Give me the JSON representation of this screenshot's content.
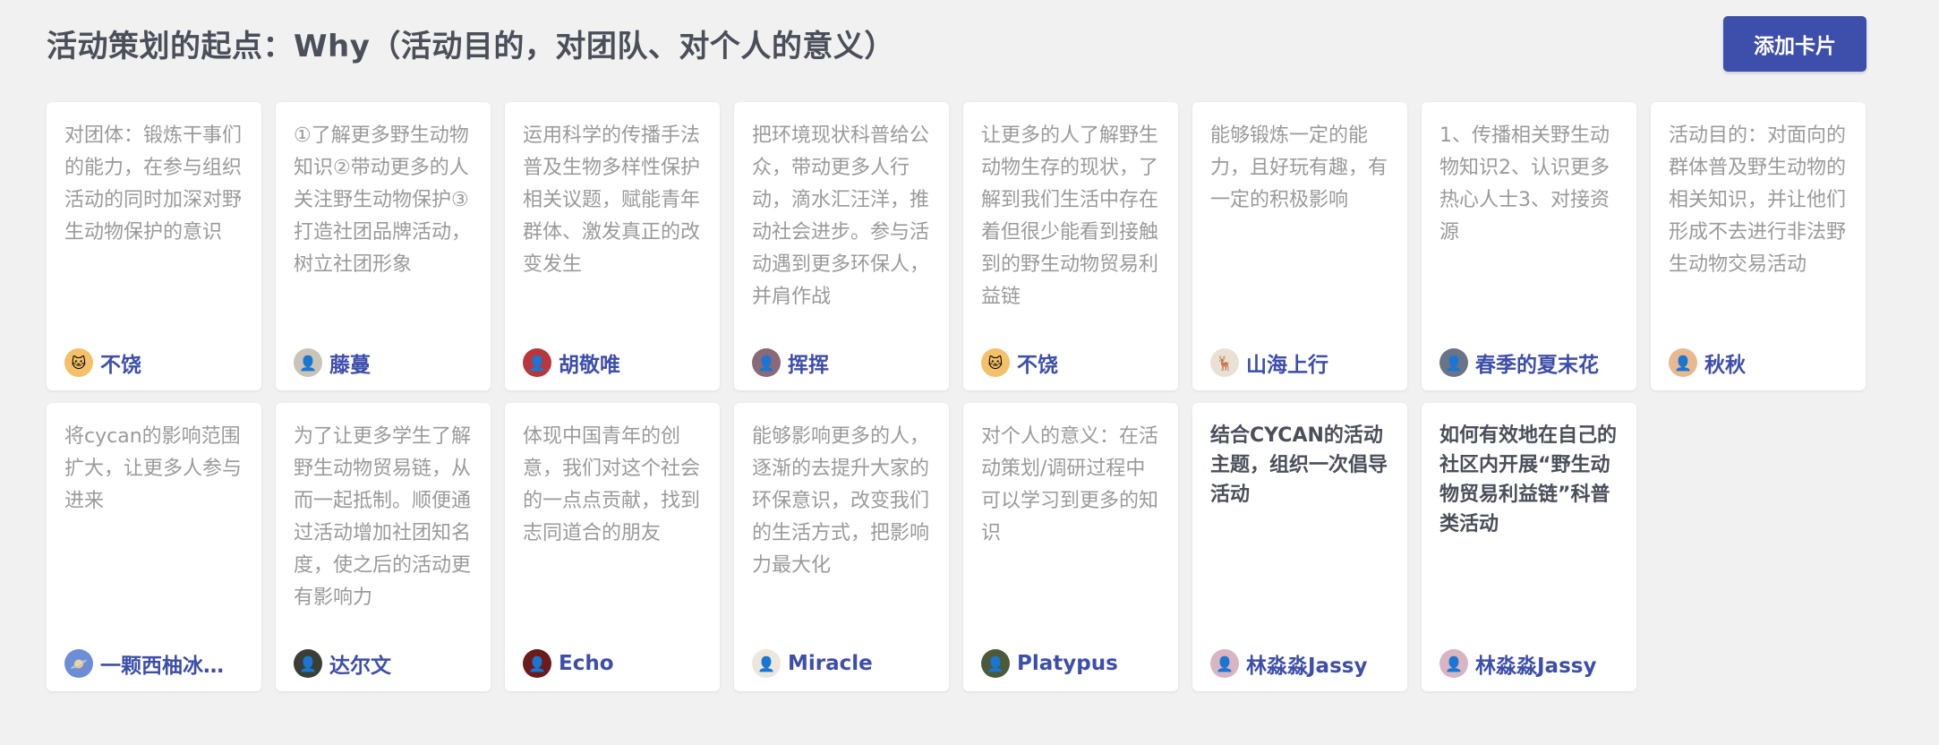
{
  "header": {
    "title": "活动策划的起点：Why（活动目的，对团队、对个人的意义）",
    "add_button_label": "添加卡片"
  },
  "colors": {
    "background": "#f1f1f1",
    "accent": "#3d4eab",
    "body_text": "#9a9a9a",
    "title_text": "#4a4f5a"
  },
  "cards": [
    {
      "content": "对团体：锻炼干事们的能力，在参与组织活动的同时加深对野生动物保护的意识",
      "author": "不饶",
      "avatar_icon": "cat-avatar-icon",
      "avatar_color": "#f4c06a",
      "avatar_glyph": "🐱"
    },
    {
      "content": "①了解更多野生动物知识②带动更多的人关注野生动物保护③打造社团品牌活动，树立社团形象",
      "author": "藤蔓",
      "avatar_icon": "person-avatar-icon",
      "avatar_color": "#c9c3b8",
      "avatar_glyph": "👤"
    },
    {
      "content": "运用科学的传播手法普及生物多样性保护相关议题，赋能青年群体、激发真正的改变发生",
      "author": "胡敬唯",
      "avatar_icon": "person-avatar-icon",
      "avatar_color": "#b8373d",
      "avatar_glyph": "👤"
    },
    {
      "content": "把环境现状科普给公众，带动更多人行动，滴水汇汪洋，推动社会进步。参与活动遇到更多环保人，并肩作战",
      "author": "挥挥",
      "avatar_icon": "person-avatar-icon",
      "avatar_color": "#8a6a78",
      "avatar_glyph": "👤"
    },
    {
      "content": "让更多的人了解野生动物生存的现状，了解到我们生活中存在着但很少能看到接触到的野生动物贸易利益链",
      "author": "不饶",
      "avatar_icon": "cat-avatar-icon",
      "avatar_color": "#f4c06a",
      "avatar_glyph": "🐱"
    },
    {
      "content": "能够锻炼一定的能力，且好玩有趣，有一定的积极影响",
      "author": "山海上行",
      "avatar_icon": "deer-avatar-icon",
      "avatar_color": "#e9e2d4",
      "avatar_glyph": "🦌"
    },
    {
      "content": "1、传播相关野生动物知识2、认识更多热心人士3、对接资源",
      "author": "春季的夏末花",
      "avatar_icon": "person-avatar-icon",
      "avatar_color": "#6b7487",
      "avatar_glyph": "👤"
    },
    {
      "content": "活动目的：对面向的群体普及野生动物的相关知识，并让他们形成不去进行非法野生动物交易活动",
      "author": "秋秋",
      "avatar_icon": "person-avatar-icon",
      "avatar_color": "#e8b98f",
      "avatar_glyph": "👤"
    },
    {
      "content": "将cycan的影响范围扩大，让更多人参与进来",
      "author": "一颗西柚冰…",
      "avatar_icon": "planet-avatar-icon",
      "avatar_color": "#6d8ed6",
      "avatar_glyph": "🪐"
    },
    {
      "content": "为了让更多学生了解野生动物贸易链，从而一起抵制。顺便通过活动增加社团知名度，使之后的活动更有影响力",
      "author": "达尔文",
      "avatar_icon": "person-avatar-icon",
      "avatar_color": "#3a3f36",
      "avatar_glyph": "👤"
    },
    {
      "content": "体现中国青年的创意，我们对这个社会的一点点贡献，找到志同道合的朋友",
      "author": "Echo",
      "avatar_icon": "person-avatar-icon",
      "avatar_color": "#6b1b1b",
      "avatar_glyph": "👤"
    },
    {
      "content": "能够影响更多的人，逐渐的去提升大家的环保意识，改变我们的生活方式，把影响力最大化",
      "author": "Miracle",
      "avatar_icon": "person-avatar-icon",
      "avatar_color": "#ece6dc",
      "avatar_glyph": "👤"
    },
    {
      "content": "对个人的意义：在活动策划/调研过程中可以学习到更多的知识",
      "author": "Platypus",
      "avatar_icon": "person-avatar-icon",
      "avatar_color": "#4d5a3a",
      "avatar_glyph": "👤"
    },
    {
      "content": "结合CYCAN的活动主题，组织一次倡导活动",
      "author": "林淼淼Jassy",
      "avatar_icon": "person-avatar-icon",
      "avatar_color": "#d9b4c2",
      "avatar_glyph": "👤",
      "is_title": true
    },
    {
      "content": "如何有效地在自己的社区内开展“野生动物贸易利益链”科普类活动",
      "author": "林淼淼Jassy",
      "avatar_icon": "person-avatar-icon",
      "avatar_color": "#d9b4c2",
      "avatar_glyph": "👤",
      "is_title": true
    }
  ]
}
